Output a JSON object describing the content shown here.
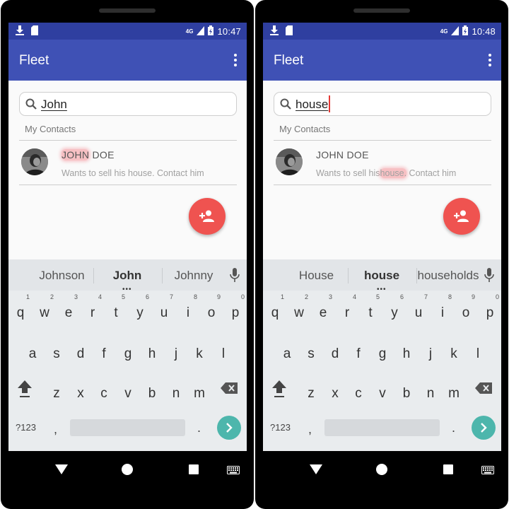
{
  "phones": [
    {
      "time": "10:47",
      "network": "4G",
      "app_title": "Fleet",
      "search_query": "John",
      "section_label": "My Contacts",
      "contact": {
        "name_highlight": "JOHN",
        "name_rest": " DOE",
        "desc_before": "Wants to sell his house. Contact him",
        "desc_highlight": "",
        "desc_after": ""
      },
      "suggestions": [
        "Johnson",
        "John",
        "Johnny"
      ]
    },
    {
      "time": "10:48",
      "network": "4G",
      "app_title": "Fleet",
      "search_query": "house",
      "section_label": "My Contacts",
      "contact": {
        "name_highlight": "",
        "name_rest": "JOHN DOE",
        "desc_before": "Wants to sell his",
        "desc_highlight": "house.",
        "desc_after": " Contact him"
      },
      "suggestions": [
        "House",
        "house",
        "households"
      ]
    }
  ],
  "keyboard": {
    "row1": [
      "q",
      "w",
      "e",
      "r",
      "t",
      "y",
      "u",
      "i",
      "o",
      "p"
    ],
    "row1_numbers": [
      "1",
      "2",
      "3",
      "4",
      "5",
      "6",
      "7",
      "8",
      "9",
      "0"
    ],
    "row2": [
      "a",
      "s",
      "d",
      "f",
      "g",
      "h",
      "j",
      "k",
      "l"
    ],
    "row3": [
      "z",
      "x",
      "c",
      "v",
      "b",
      "n",
      "m"
    ],
    "symbols_label": "?123",
    "comma": ",",
    "period": "."
  },
  "icons": {
    "statusbar_left": [
      "download-icon",
      "sd-card-icon"
    ],
    "statusbar_right": [
      "signal-icon",
      "battery-charging-icon"
    ],
    "fab": "add-person-icon",
    "search": "search-icon",
    "mic": "mic-icon",
    "shift": "shift-icon",
    "backspace": "backspace-icon",
    "enter": "chevron-right-icon",
    "nav": [
      "back-icon",
      "home-icon",
      "recents-icon",
      "keyboard-icon"
    ]
  },
  "colors": {
    "primary": "#3f51b5",
    "primary_dark": "#2f3fa0",
    "fab": "#ef5350",
    "highlight": "#f48f96",
    "enter": "#4db6ac"
  }
}
